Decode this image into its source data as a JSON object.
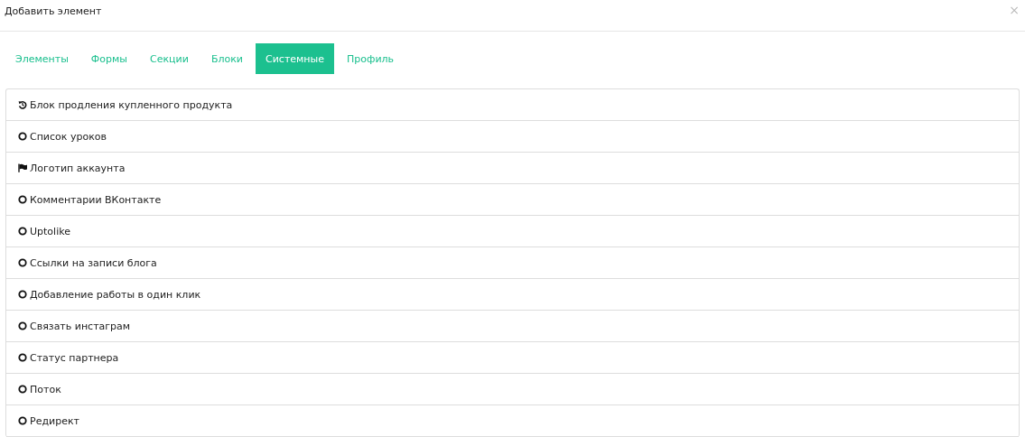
{
  "dialog": {
    "title": "Добавить элемент",
    "close": "×"
  },
  "tabs": [
    {
      "label": "Элементы",
      "selected": false
    },
    {
      "label": "Формы",
      "selected": false
    },
    {
      "label": "Секции",
      "selected": false
    },
    {
      "label": "Блоки",
      "selected": false
    },
    {
      "label": "Системные",
      "selected": true
    },
    {
      "label": "Профиль",
      "selected": false
    }
  ],
  "items": [
    {
      "label": "Блок продления купленного продукта",
      "kind": "history"
    },
    {
      "label": "Список уроков",
      "kind": "circle"
    },
    {
      "label": "Логотип аккаунта",
      "kind": "flag"
    },
    {
      "label": "Комментарии ВКонтакте",
      "kind": "circle"
    },
    {
      "label": "Uptolike",
      "kind": "circle"
    },
    {
      "label": "Ссылки на записи блога",
      "kind": "circle"
    },
    {
      "label": "Добавление работы в один клик",
      "kind": "circle"
    },
    {
      "label": "Связать инстаграм",
      "kind": "circle"
    },
    {
      "label": "Статус партнера",
      "kind": "circle"
    },
    {
      "label": "Поток",
      "kind": "circle"
    },
    {
      "label": "Редирект",
      "kind": "circle"
    }
  ]
}
